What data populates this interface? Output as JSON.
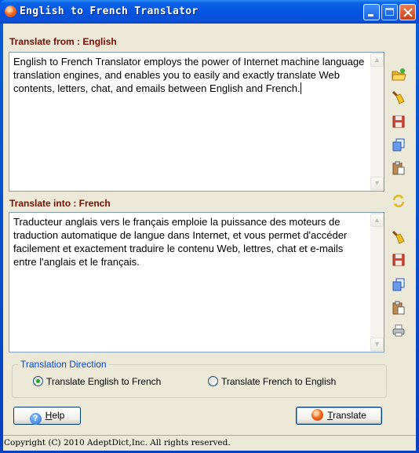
{
  "window": {
    "title": "English to French Translator",
    "controls": {
      "minimize": "minimize",
      "maximize": "maximize",
      "close": "close"
    }
  },
  "source": {
    "label": "Translate from : English",
    "text": "English to French Translator employs the power of Internet machine language translation engines, and enables you to easily and exactly translate Web contents, letters, chat, and emails between English and French."
  },
  "target": {
    "label": "Translate into : French",
    "text": "Traducteur anglais vers le français emploie la puissance des moteurs de traduction automatique de langue dans Internet, et vous permet d'accéder facilement et exactement traduire le contenu Web, lettres, chat et e-mails entre l'anglais et le français."
  },
  "side_toolbar": {
    "source_tools": [
      "open-file-icon",
      "clear-icon",
      "save-icon",
      "copy-icon",
      "paste-icon"
    ],
    "swap": "swap-icon",
    "target_tools": [
      "clear-icon",
      "save-icon",
      "copy-icon",
      "paste-icon",
      "print-icon"
    ]
  },
  "direction": {
    "title": "Translation Direction",
    "options": [
      {
        "label": "Translate English to French",
        "selected": true
      },
      {
        "label": "Translate French to English",
        "selected": false
      }
    ]
  },
  "buttons": {
    "help": {
      "accel": "H",
      "rest": "elp"
    },
    "translate": {
      "accel": "T",
      "rest": "ranslate"
    }
  },
  "status": {
    "text": "Copyright (C) 2010 AdeptDict,Inc. All rights reserved."
  },
  "colors": {
    "label": "#7a0c00",
    "group_title": "#0046d5",
    "title_bar": "#0454e0"
  }
}
